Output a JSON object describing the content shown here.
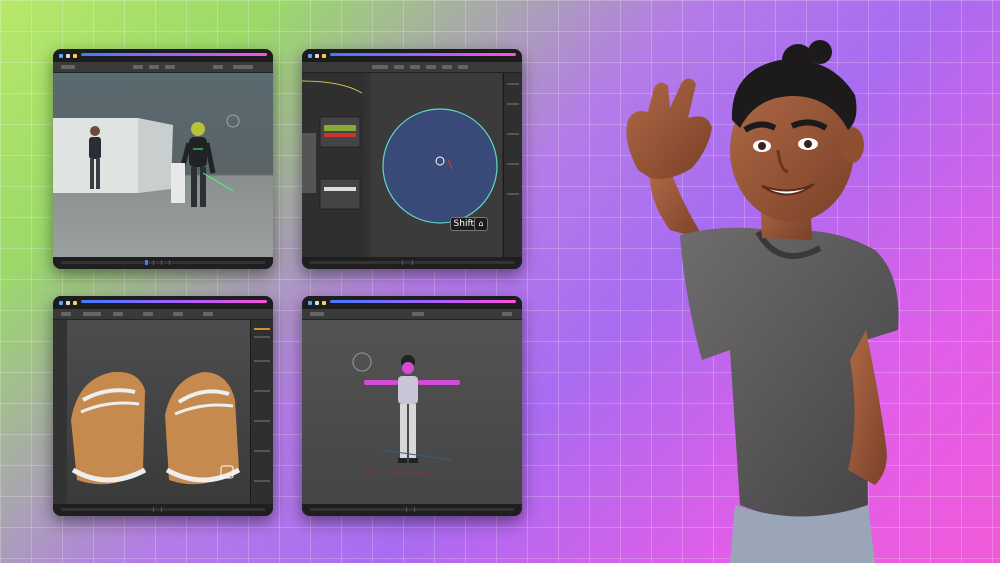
{
  "windows": [
    {
      "name": "window-motion-capture",
      "toolbar_items": 6
    },
    {
      "name": "window-texture-paint",
      "toolbar_items": 10
    },
    {
      "name": "window-shoe-modeling",
      "toolbar_items": 10
    },
    {
      "name": "window-character-rig",
      "toolbar_items": 6
    }
  ],
  "shortcut": {
    "key": "Shift"
  },
  "colors": {
    "accent_blue": "#3f7bff",
    "accent_pink": "#ff4fd8",
    "viewport_gray": "#4a4a4a"
  }
}
